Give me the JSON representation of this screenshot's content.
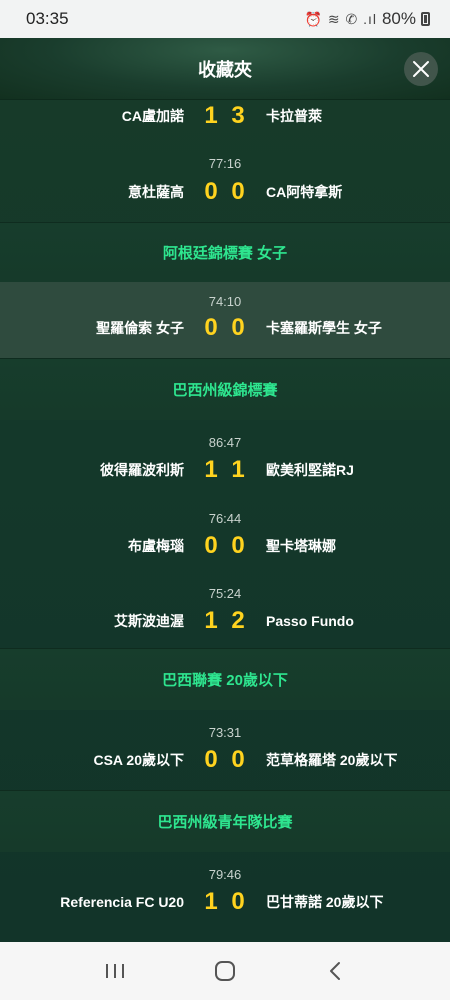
{
  "status_bar": {
    "time": "03:35",
    "icons": "⏰ ≋ ✆ .ıl",
    "battery": "80%"
  },
  "header": {
    "title": "收藏夾"
  },
  "matches_top": [
    {
      "time": "",
      "home": "CA盧加諾",
      "home_score": "1",
      "away_score": "3",
      "away": "卡拉普萊"
    },
    {
      "time": "77:16",
      "home": "意杜薩高",
      "home_score": "0",
      "away_score": "0",
      "away": "CA阿特拿斯"
    }
  ],
  "sections": [
    {
      "name": "阿根廷錦標賽 女子",
      "matches": [
        {
          "time": "74:10",
          "home": "聖羅倫索 女子",
          "home_score": "0",
          "away_score": "0",
          "away": "卡塞羅斯學生 女子"
        }
      ]
    },
    {
      "name": "巴西州級錦標賽",
      "matches": [
        {
          "time": "86:47",
          "home": "彼得羅波利斯",
          "home_score": "1",
          "away_score": "1",
          "away": "歐美利堅諾RJ"
        },
        {
          "time": "76:44",
          "home": "布盧梅瑙",
          "home_score": "0",
          "away_score": "0",
          "away": "聖卡塔琳娜"
        },
        {
          "time": "75:24",
          "home": "艾斯波迪渥",
          "home_score": "1",
          "away_score": "2",
          "away": "Passo Fundo"
        }
      ]
    },
    {
      "name": "巴西聯賽 20歲以下",
      "matches": [
        {
          "time": "73:31",
          "home": "CSA 20歲以下",
          "home_score": "0",
          "away_score": "0",
          "away": "范草格羅塔 20歲以下"
        }
      ]
    },
    {
      "name": "巴西州級青年隊比賽",
      "matches": [
        {
          "time": "79:46",
          "home": "Referencia FC U20",
          "home_score": "1",
          "away_score": "0",
          "away": "巴甘蒂諾 20歲以下"
        }
      ]
    }
  ],
  "colors": {
    "score": "#ffd31f",
    "section_title": "#2ee58f",
    "background": "#14382a"
  }
}
